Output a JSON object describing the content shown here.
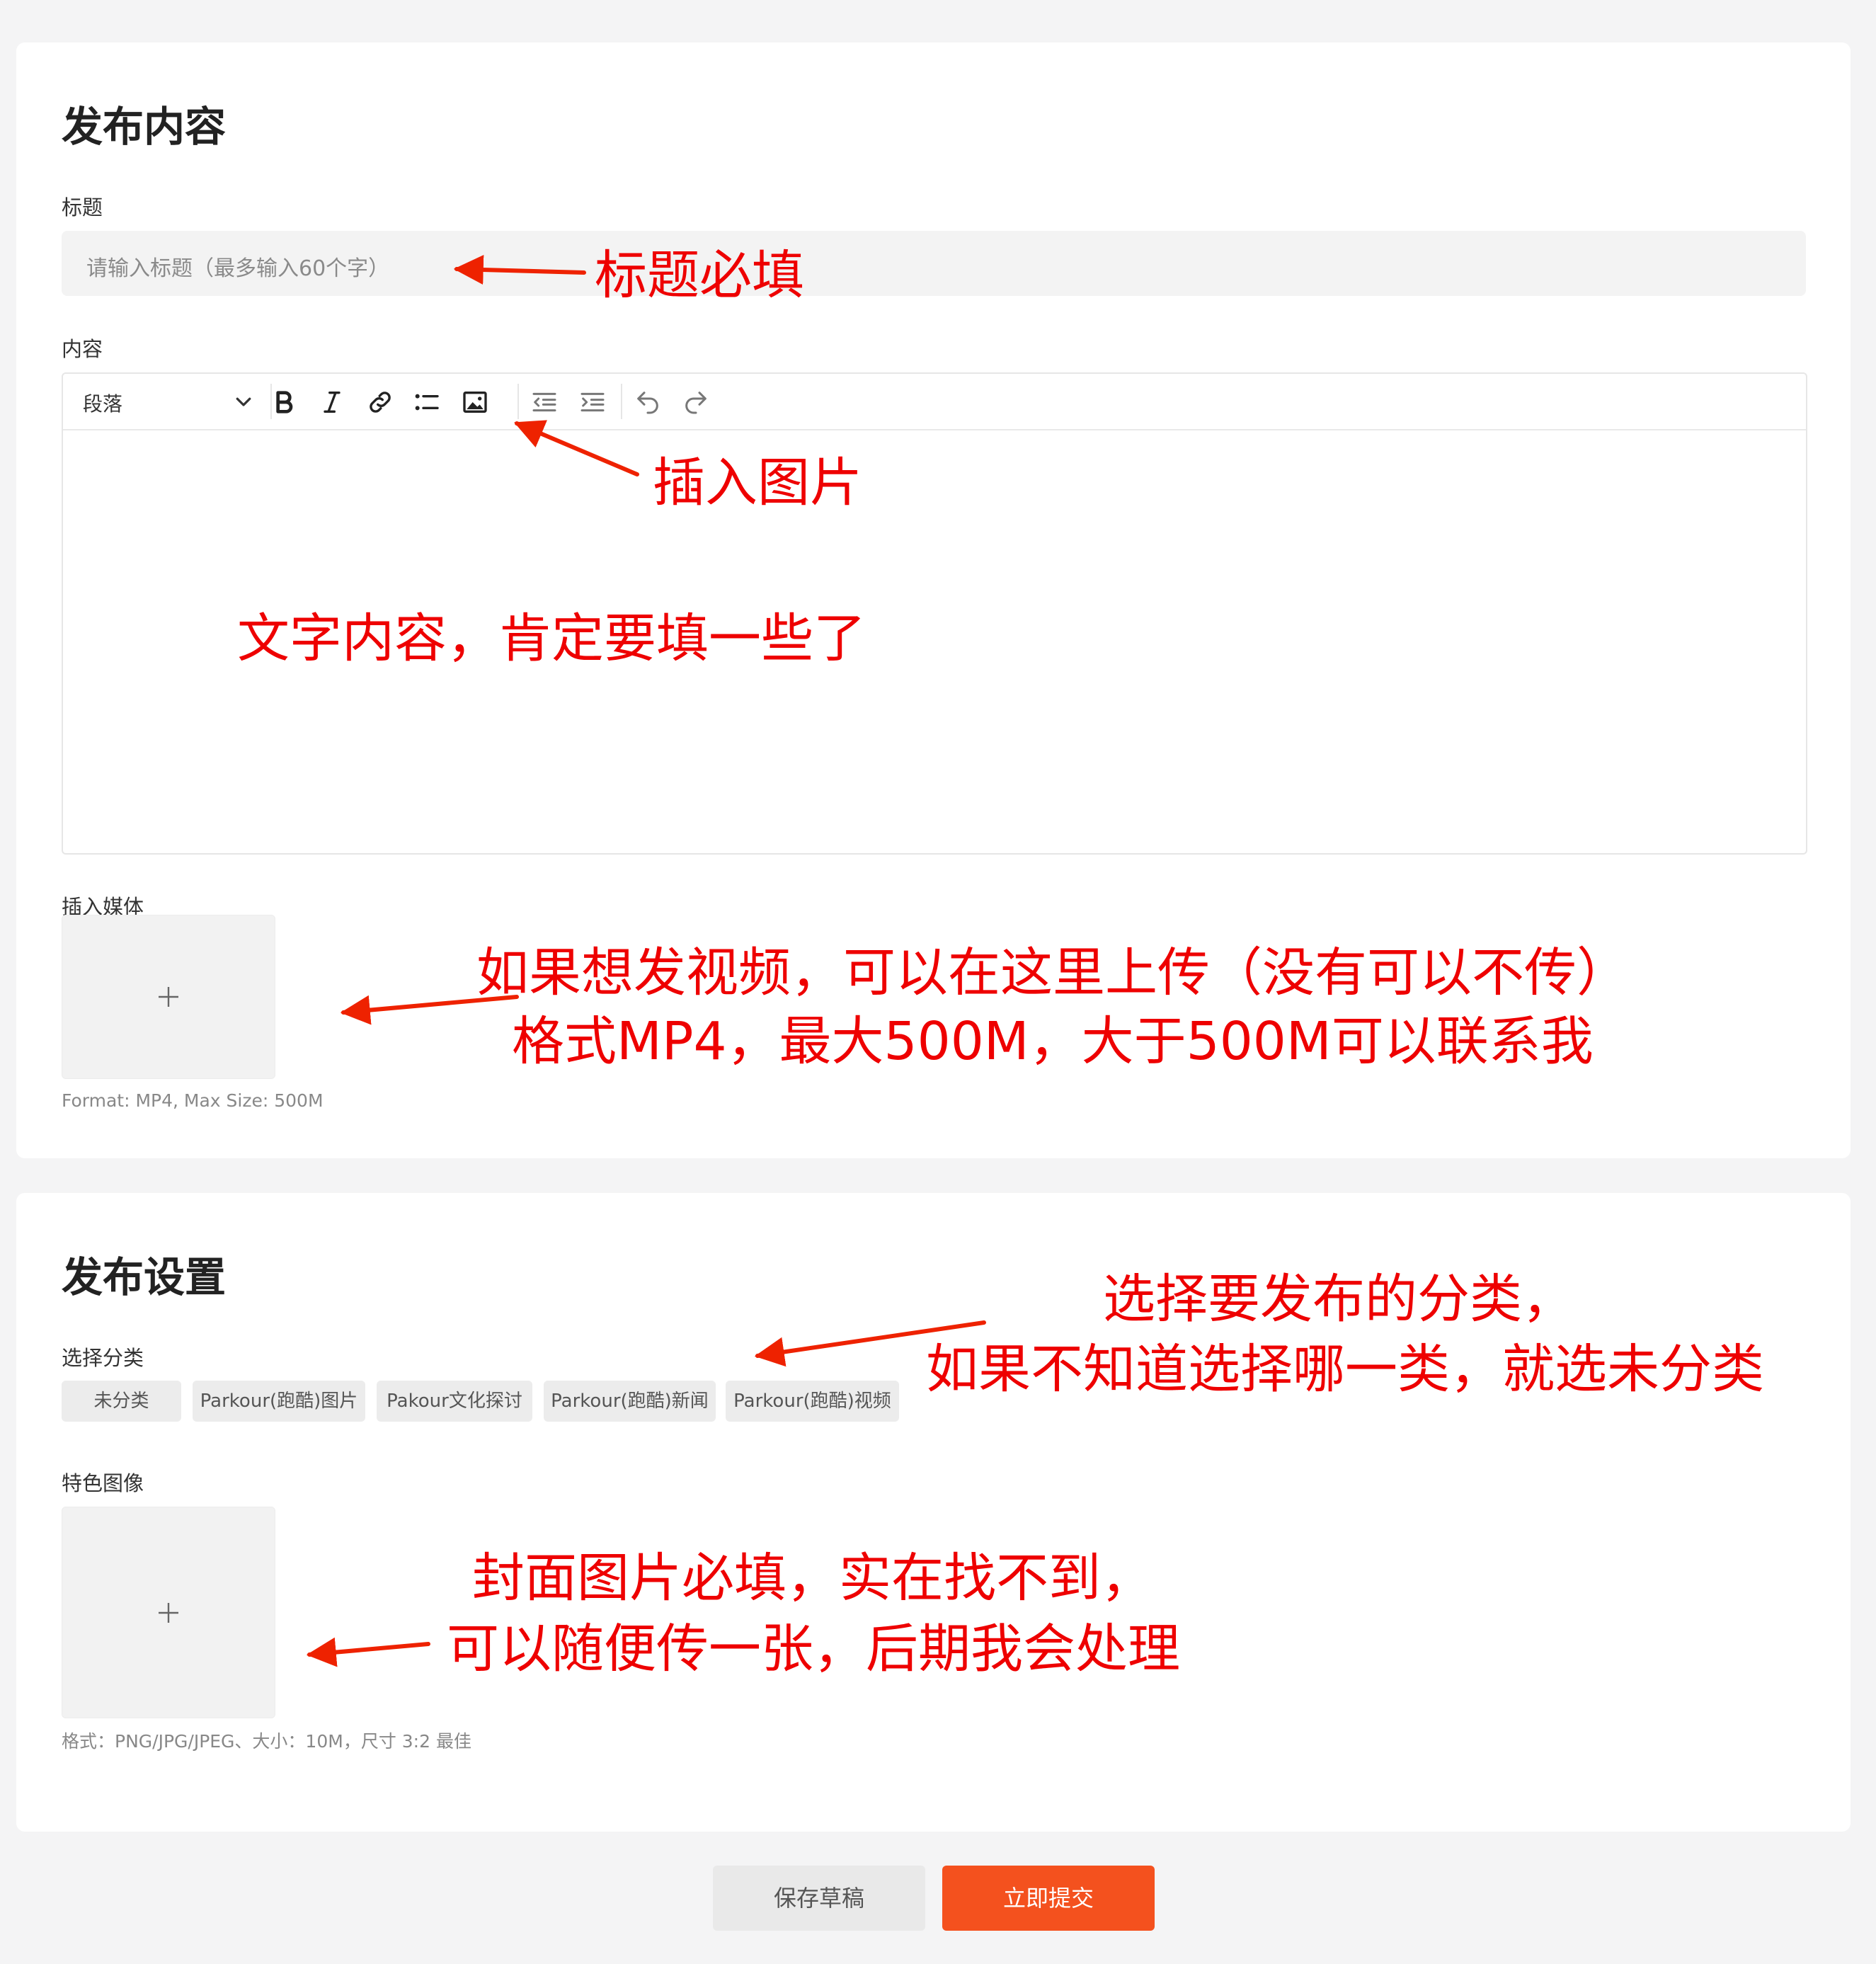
{
  "publish_content": {
    "heading": "发布内容",
    "title_label": "标题",
    "title_placeholder": "请输入标题（最多输入60个字）",
    "content_label": "内容",
    "toolbar": {
      "block_format": "段落",
      "icons": [
        "chevron-down-icon",
        "bold-icon",
        "italic-icon",
        "link-icon",
        "bulleted-list-icon",
        "insert-image-icon",
        "outdent-icon",
        "indent-icon",
        "undo-icon",
        "redo-icon"
      ]
    },
    "media_label": "插入媒体",
    "media_hint": "Format: MP4, Max Size: 500M"
  },
  "publish_settings": {
    "heading": "发布设置",
    "category_label": "选择分类",
    "categories": [
      "未分类",
      "Parkour(跑酷)图片",
      "Pakour文化探讨",
      "Parkour(跑酷)新闻",
      "Parkour(跑酷)视频"
    ],
    "featured_label": "特色图像",
    "featured_hint": "格式：PNG/JPG/JPEG、大小：10M，尺寸 3:2 最佳"
  },
  "actions": {
    "save_draft": "保存草稿",
    "submit": "立即提交"
  },
  "annotations": {
    "title_required": "标题必填",
    "insert_image": "插入图片",
    "content_note": "文字内容，肯定要填一些了",
    "video_line1": "如果想发视频，可以在这里上传（没有可以不传）",
    "video_line2": "格式MP4，最大500M，大于500M可以联系我",
    "category_line1": "选择要发布的分类，",
    "category_line2": "如果不知道选择哪一类，就选未分类",
    "cover_line1": "封面图片必填，实在找不到，",
    "cover_line2": "可以随便传一张，后期我会处理"
  },
  "colors": {
    "accent": "#f4511e",
    "annotation": "#ee0000",
    "background": "#f4f4f5"
  }
}
